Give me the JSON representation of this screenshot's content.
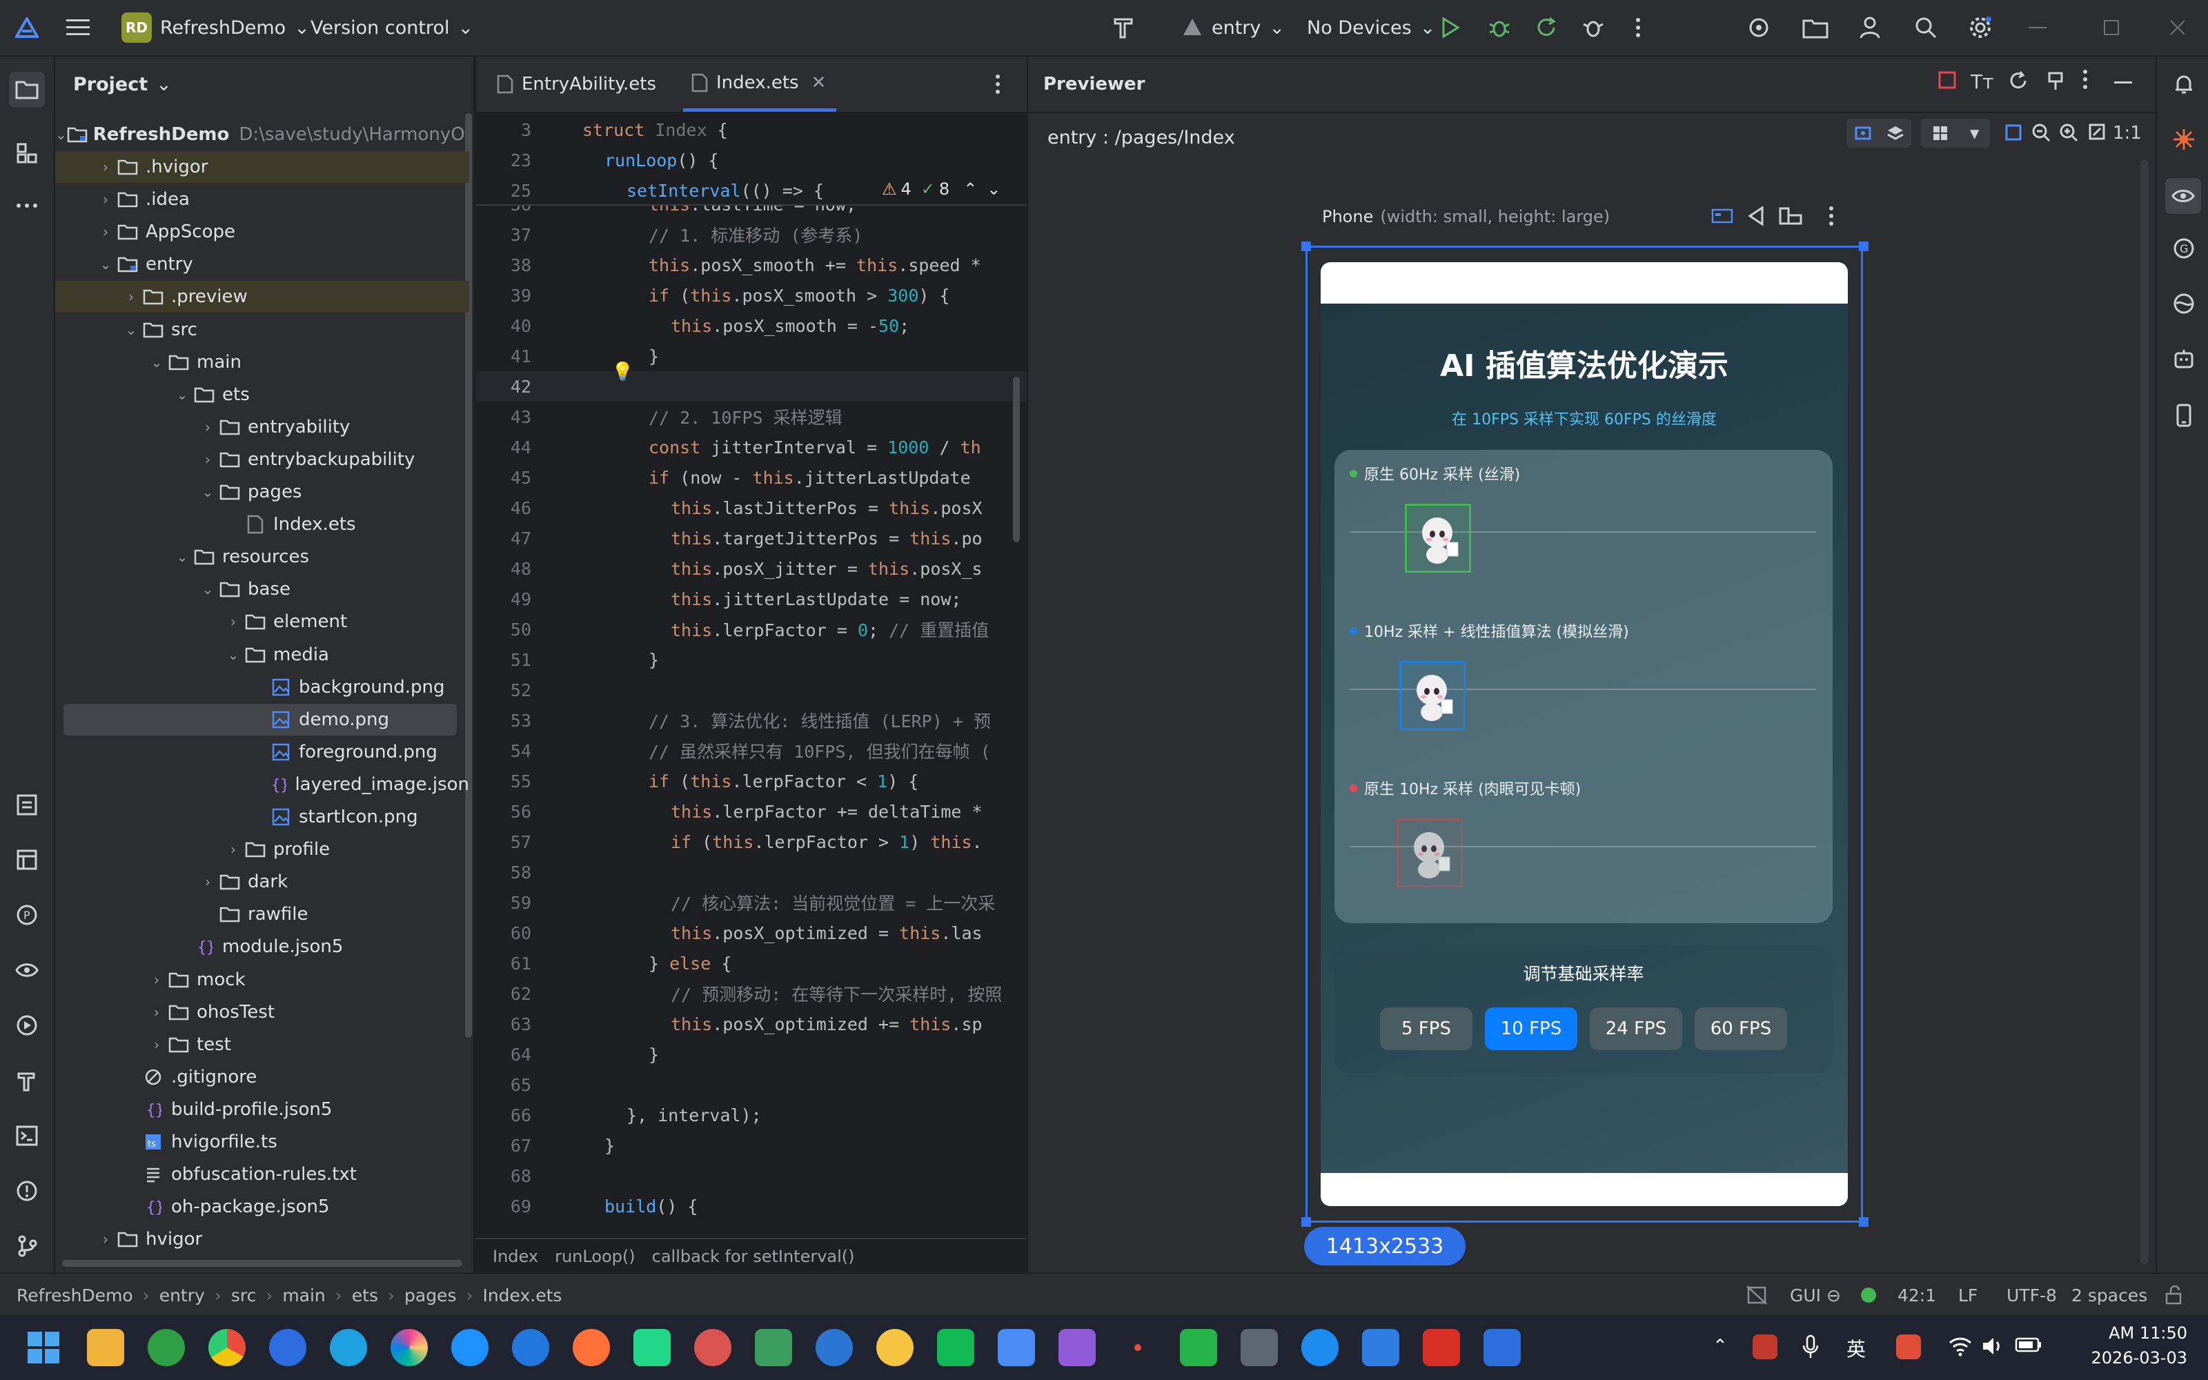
{
  "titlebar": {
    "project_initials": "RD",
    "project_name": "RefreshDemo",
    "vcs": "Version control",
    "run_config": "entry",
    "device": "No Devices"
  },
  "project_panel": {
    "title": "Project",
    "root_name": "RefreshDemo",
    "root_path": "D:\\save\\study\\HarmonyOS_",
    "items": [
      {
        "label": ".hvigor"
      },
      {
        "label": ".idea"
      },
      {
        "label": "AppScope"
      },
      {
        "label": "entry"
      },
      {
        "label": ".preview"
      },
      {
        "label": "src"
      },
      {
        "label": "main"
      },
      {
        "label": "ets"
      },
      {
        "label": "entryability"
      },
      {
        "label": "entrybackupability"
      },
      {
        "label": "pages"
      },
      {
        "label": "Index.ets"
      },
      {
        "label": "resources"
      },
      {
        "label": "base"
      },
      {
        "label": "element"
      },
      {
        "label": "media"
      },
      {
        "label": "background.png"
      },
      {
        "label": "demo.png"
      },
      {
        "label": "foreground.png"
      },
      {
        "label": "layered_image.json"
      },
      {
        "label": "startIcon.png"
      },
      {
        "label": "profile"
      },
      {
        "label": "dark"
      },
      {
        "label": "rawfile"
      },
      {
        "label": "module.json5"
      },
      {
        "label": "mock"
      },
      {
        "label": "ohosTest"
      },
      {
        "label": "test"
      },
      {
        "label": ".gitignore"
      },
      {
        "label": "build-profile.json5"
      },
      {
        "label": "hvigorfile.ts"
      },
      {
        "label": "obfuscation-rules.txt"
      },
      {
        "label": "oh-package.json5"
      },
      {
        "label": "hvigor"
      }
    ]
  },
  "editor": {
    "tabs": [
      "EntryAbility.ets",
      "Index.ets"
    ],
    "warnings": "4",
    "checks": "8",
    "breadcrumb": [
      "Index",
      "runLoop()",
      "callback for setInterval()"
    ]
  },
  "previewer": {
    "title": "Previewer",
    "path": "entry : /pages/Index",
    "device_name": "Phone",
    "device_spec": "(width: small, height: large)",
    "zoom_label": "1:1",
    "resolution": "1413x2533"
  },
  "app": {
    "title": "AI 插值算法优化演示",
    "subtitle": "在 10FPS 采样下实现 60FPS 的丝滑度",
    "lanes": [
      {
        "label": "原生 60Hz 采样 (丝滑)",
        "color": "#3fb950"
      },
      {
        "label": "10Hz 采样 + 线性插值算法 (模拟丝滑)",
        "color": "#1f7fe0"
      },
      {
        "label": "原生 10Hz 采样 (肉眼可见卡顿)",
        "color": "#e5484d"
      }
    ],
    "sampling_title": "调节基础采样率",
    "fps_options": [
      "5 FPS",
      "10 FPS",
      "24 FPS",
      "60 FPS"
    ],
    "selected_fps": "10 FPS"
  },
  "statusbar": {
    "path": [
      "RefreshDemo",
      "entry",
      "src",
      "main",
      "ets",
      "pages",
      "Index.ets"
    ],
    "gui": "GUI",
    "position": "42:1",
    "line_sep": "LF",
    "encoding": "UTF-8",
    "indent": "2 spaces"
  },
  "taskbar": {
    "input_lang": "英",
    "time": "AM 11:50",
    "date": "2026-03-03"
  }
}
